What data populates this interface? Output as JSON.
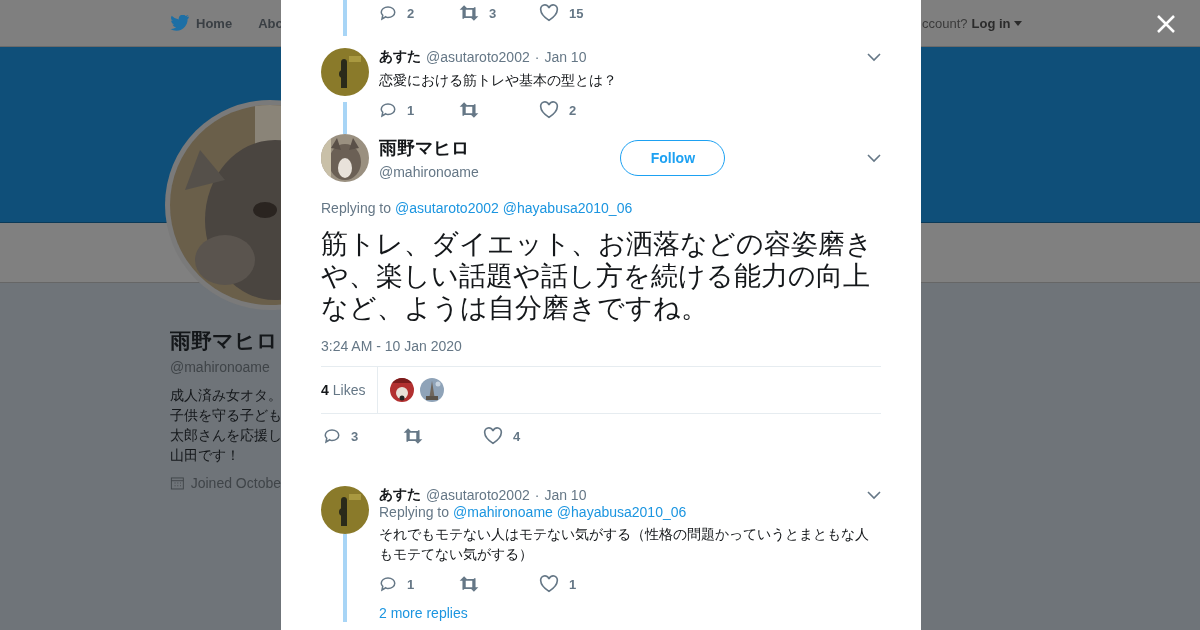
{
  "nav": {
    "items": [
      {
        "label": "Home"
      },
      {
        "label": "Abo"
      }
    ],
    "account_prompt": "ccount?",
    "login": "Log in"
  },
  "profile": {
    "name": "雨野マヒロ",
    "handle": "@mahironoame",
    "bio": [
      "成人済み女オタ。",
      "子供を守る子ども",
      "太郎さんを応援し",
      "山田です！"
    ],
    "joined": "Joined Octobe"
  },
  "modal": {
    "top_actions": {
      "replies": "2",
      "retweets": "3",
      "likes": "15"
    },
    "tweets": [
      {
        "kind": "reply",
        "name": "あすた",
        "handle": "@asutaroto2002",
        "sep": "·",
        "date": "Jan 10",
        "text": "恋愛における筋トレや基本の型とは？",
        "actions": {
          "replies": "1",
          "likes": "2"
        }
      },
      {
        "kind": "main",
        "name": "雨野マヒロ",
        "handle": "@mahironoame",
        "follow": "Follow",
        "replying_label": "Replying to",
        "replying_to": [
          "@asutaroto2002",
          "@hayabusa2010_06"
        ],
        "text": "筋トレ、ダイエット、お洒落などの容姿磨きや、楽しい話題や話し方を続ける能力の向上など、ようは自分磨きですね。",
        "time": "3:24 AM - 10 Jan 2020",
        "likes_count": "4",
        "likes_label": "Likes",
        "actions": {
          "replies": "3",
          "likes": "4"
        }
      },
      {
        "kind": "reply",
        "name": "あすた",
        "handle": "@asutaroto2002",
        "sep": "·",
        "date": "Jan 10",
        "replying_label": "Replying to",
        "replying_to": [
          "@mahironoame",
          "@hayabusa2010_06"
        ],
        "text": "それでもモテない人はモテない気がする（性格の問題かっていうとまともな人もモテてない気がする）",
        "actions": {
          "replies": "1",
          "likes": "1"
        }
      }
    ],
    "more_replies": "2 more replies"
  }
}
